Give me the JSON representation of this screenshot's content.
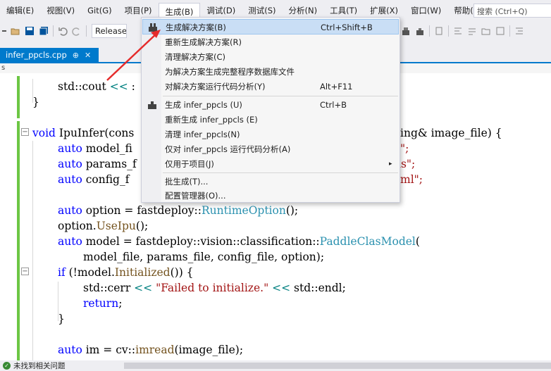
{
  "menubar": {
    "items": [
      {
        "label": "编辑(E)"
      },
      {
        "label": "视图(V)"
      },
      {
        "label": "Git(G)"
      },
      {
        "label": "项目(P)"
      },
      {
        "label": "生成(B)"
      },
      {
        "label": "调试(D)"
      },
      {
        "label": "测试(S)"
      },
      {
        "label": "分析(N)"
      },
      {
        "label": "工具(T)"
      },
      {
        "label": "扩展(X)"
      },
      {
        "label": "窗口(W)"
      },
      {
        "label": "帮助(H)"
      }
    ],
    "search_placeholder": "搜索 (Ctrl+Q)"
  },
  "toolbar": {
    "config": "Release"
  },
  "tab": {
    "filename": "infer_ppcls.cpp",
    "pin": "⊕",
    "close": "✕"
  },
  "nav_strip": "s",
  "build_menu": {
    "items": [
      {
        "label": "生成解决方案(B)",
        "shortcut": "Ctrl+Shift+B",
        "icon": "build-solution-icon"
      },
      {
        "label": "重新生成解决方案(R)",
        "shortcut": ""
      },
      {
        "label": "清理解决方案(C)",
        "shortcut": ""
      },
      {
        "label": "为解决方案生成完整程序数据库文件",
        "shortcut": ""
      },
      {
        "label": "对解决方案运行代码分析(Y)",
        "shortcut": "Alt+F11"
      },
      {
        "label": "生成 infer_ppcls (U)",
        "shortcut": "Ctrl+B",
        "icon": "build-project-icon"
      },
      {
        "label": "重新生成 infer_ppcls (E)",
        "shortcut": ""
      },
      {
        "label": "清理 infer_ppcls(N)",
        "shortcut": ""
      },
      {
        "label": "仅对 infer_ppcls 运行代码分析(A)",
        "shortcut": ""
      },
      {
        "label": "仅用于项目(J)",
        "shortcut": "",
        "submenu": "▸"
      },
      {
        "label": "批生成(T)...",
        "shortcut": ""
      },
      {
        "label": "配置管理器(O)...",
        "shortcut": ""
      }
    ]
  },
  "code": {
    "l1": {
      "a": "std::cout ",
      "b": "<<",
      "c": " :"
    },
    "l2": "}",
    "l3": {
      "kw": "void",
      "name": " IpuInfer(cons",
      "tail": "ing& image_file) {"
    },
    "l4": {
      "kw": "auto",
      "a": " model_fi",
      "str": "\";"
    },
    "l5": {
      "kw": "auto",
      "a": " params_f",
      "str": "ams\";"
    },
    "l6": {
      "kw": "auto",
      "a": " config_f",
      "str": "ml\";"
    },
    "l7": {
      "kw": "auto",
      "a": " option = fastdeploy::",
      "ty": "RuntimeOption",
      "b": "();"
    },
    "l8": {
      "a": "option.",
      "fn": "UseIpu",
      "b": "();"
    },
    "l9": {
      "kw": "auto",
      "a": " model = fastdeploy::vision::classification::",
      "ty": "PaddleClasModel",
      "b": "("
    },
    "l10": "model_file, params_file, config_file, option);",
    "l11": {
      "kw": "if",
      "a": " (!model.",
      "fn": "Initialized",
      "b": "()) {"
    },
    "l12": {
      "a": "std::cerr ",
      "op": "<<",
      "str": " \"Failed to initialize.\" ",
      "op2": "<<",
      "b": " std::endl;"
    },
    "l13": {
      "kw": "return",
      "b": ";"
    },
    "l14": "}",
    "l15": {
      "kw": "auto",
      "a": " im = cv::",
      "fn": "imread",
      "b": "(image_file);"
    }
  },
  "status": {
    "text": "未找到相关问题"
  }
}
